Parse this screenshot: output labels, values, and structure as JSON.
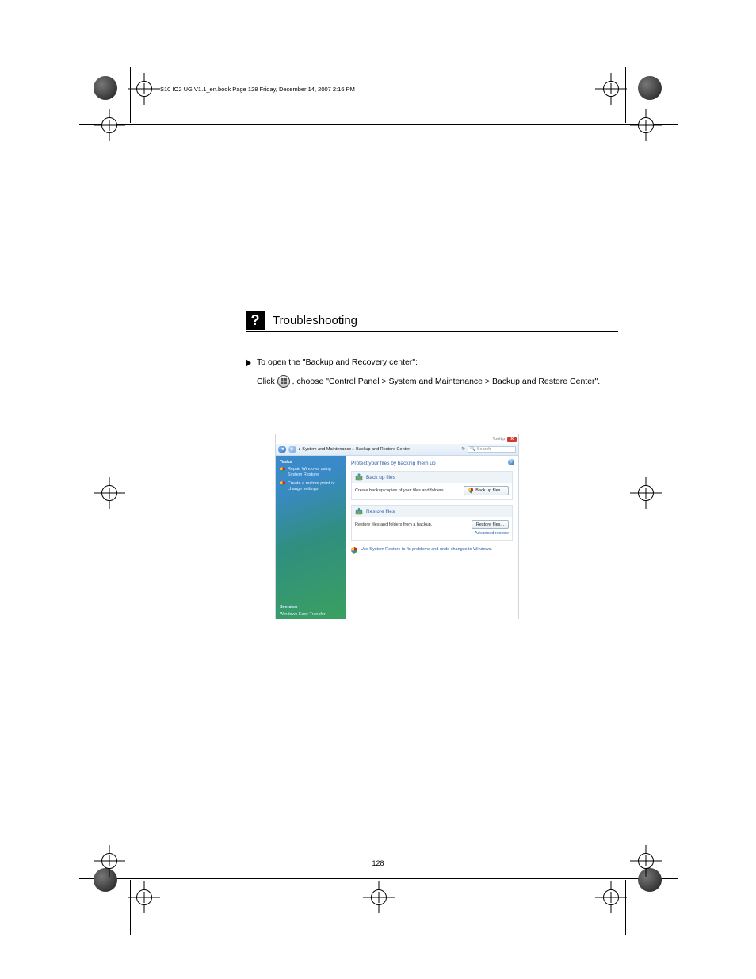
{
  "page_number": "128",
  "footer": "S10 IO2 UG V1.1_en.book  Page 128  Friday, December 14, 2007  2:16 PM",
  "section": {
    "title": "Troubleshooting",
    "instruction_lead": "To open the \"Backup and Recovery center\":",
    "instruction_tail_before_icon": "Click ",
    "instruction_tail_after_icon": ", choose \"Control Panel > System and Maintenance > Backup and Restore Center\"."
  },
  "screenshot": {
    "titlebar": {
      "tooltip": "Tooltip",
      "close": "X"
    },
    "addressbar": {
      "breadcrumbs": "▸ System and Maintenance ▸ Backup and Restore Center",
      "refresh": "↻",
      "search_placeholder": "Search"
    },
    "sidebar": {
      "tasks_heading": "Tasks",
      "task1": "Repair Windows using System Restore",
      "task2": "Create a restore point or change settings",
      "see_also": "See also",
      "wet": "Windows Easy Transfer"
    },
    "main": {
      "heading": "Protect your files by backing them up",
      "backup": {
        "header": "Back up files",
        "desc": "Create backup copies of your files and folders.",
        "button": "Back up files..."
      },
      "restore": {
        "header": "Restore files",
        "desc": "Restore files and folders from a backup.",
        "button": "Restore files...",
        "advanced": "Advanced restore"
      },
      "sys_restore": "Use System Restore to fix problems and undo changes to Windows."
    }
  }
}
